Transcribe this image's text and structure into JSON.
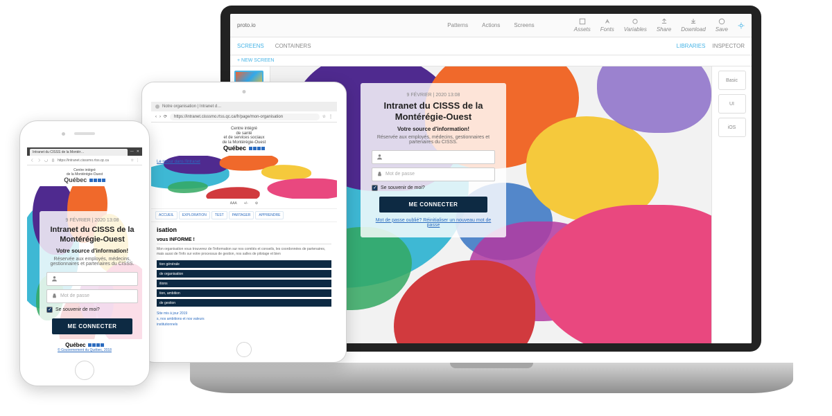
{
  "proto_toolbar": {
    "brand": "proto.io",
    "mid_items": [
      "Patterns",
      "—",
      "—",
      "Actions",
      "—",
      "Screens",
      "—"
    ],
    "right_items": [
      "Assets",
      "Fonts",
      "Variables",
      "Share",
      "Download",
      "Save"
    ]
  },
  "proto_subbar": {
    "tabs": [
      "SCREENS",
      "CONTAINERS"
    ],
    "right": [
      "LIBRARIES",
      "INSPECTOR"
    ]
  },
  "proto_bluebar": "+ NEW SCREEN",
  "proto_right_panel": [
    "Basic",
    "UI",
    "iOS",
    "…"
  ],
  "datetime": "9 FÉVRIER | 2020 13:08",
  "login": {
    "title": "Intranet du CISSS de la Montérégie-Ouest",
    "subtitle": "Votre source d'information!",
    "note": "Réservée aux employés, médecins, gestionnaires et partenaires du CISSS.",
    "user_placeholder": "",
    "pass_placeholder": "Mot de passe",
    "remember": "Se souvenir de moi?",
    "button": "ME CONNECTER",
    "forgot": "Mot de passe oublié? Réinitialiser un nouveau mot de passe"
  },
  "tablet": {
    "tab_title": "Notre organisation | Intranet d…",
    "url": "https://intranet.cisssmo.rtss.qc.ca/fr/page/mon-organisation",
    "logo_lines": [
      "Centre intégré",
      "de santé",
      "et de services sociaux",
      "de la Montérégie-Ouest"
    ],
    "logo_qc": "Québec",
    "hero_link": "Le retour dans l'intranet",
    "navrow": [
      "AAA",
      "+/-",
      "⚙"
    ],
    "menu": [
      "ACCUEIL",
      "EXPLORATION",
      "TEST",
      "PARTAGER",
      "APPRENDRE"
    ],
    "h1": "isation",
    "h2": "vous INFORME !",
    "para": "Mon organisation vous trouverez de l'information sur nos comités et conseils, les coordonnées de partenaires, mais aussi de l'info sur votre processus de gestion, nos salles de pilotage et bien",
    "bars": [
      "tion générale",
      "de organisation",
      "itions",
      "tion, ambition",
      "de gestion"
    ],
    "footer": [
      "Site mis à jour 2019",
      "",
      "s, nos ambitions et nos valeurs",
      "institutionnels"
    ]
  },
  "phone": {
    "tab_title": "Intranet du CISSS de la Montér…",
    "url": "https://intranet.cisssmo.rtss.qc.ca",
    "footer_qc": "Québec",
    "footer_link": "© Gouvernement du Québec, 2018"
  },
  "colors": {
    "navy": "#0d2a43",
    "link": "#2b6bbf",
    "proto_accent": "#47b4e6"
  }
}
